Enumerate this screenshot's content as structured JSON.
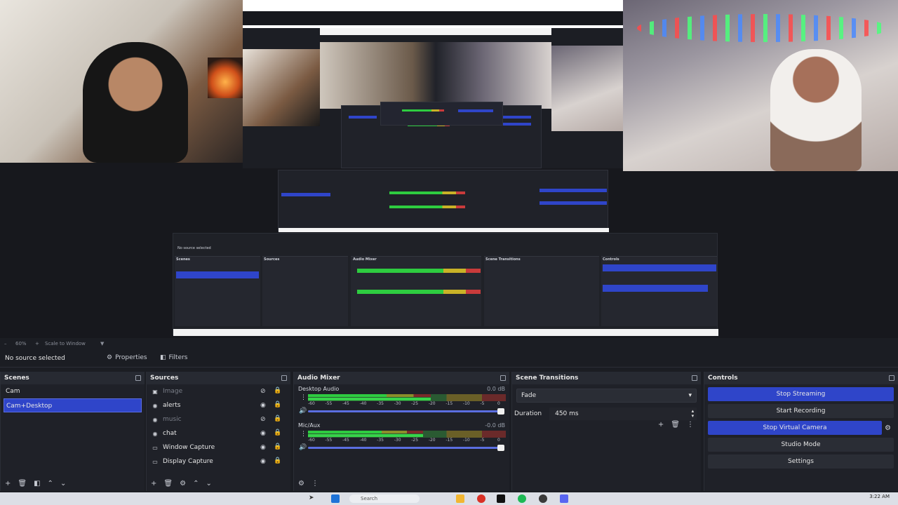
{
  "preview_toolbar": {
    "zoom": "60%",
    "scale_mode": "Scale to Window"
  },
  "source_toolbar": {
    "no_source": "No source selected",
    "properties": "Properties",
    "filters": "Filters"
  },
  "scenes": {
    "title": "Scenes",
    "items": [
      {
        "label": "Cam"
      },
      {
        "label": "Cam+Desktop",
        "selected": true
      }
    ]
  },
  "sources": {
    "title": "Sources",
    "items": [
      {
        "label": "Image",
        "icon": "image-icon",
        "visible": false
      },
      {
        "label": "alerts",
        "icon": "browser-icon",
        "visible": true
      },
      {
        "label": "music",
        "icon": "browser-icon",
        "visible": false
      },
      {
        "label": "chat",
        "icon": "browser-icon",
        "visible": true
      },
      {
        "label": "Window Capture",
        "icon": "window-icon",
        "visible": true
      },
      {
        "label": "Display Capture",
        "icon": "display-icon",
        "visible": true
      }
    ]
  },
  "mixer": {
    "title": "Audio Mixer",
    "channels": [
      {
        "name": "Desktop Audio",
        "db": "0.0 dB",
        "level": 0.62
      },
      {
        "name": "Mic/Aux",
        "db": "-0.0 dB",
        "level": 0.58
      }
    ],
    "scale": [
      "-60",
      "-55",
      "-45",
      "-40",
      "-35",
      "-30",
      "-25",
      "-20",
      "-15",
      "-10",
      "-5",
      "0"
    ]
  },
  "transitions": {
    "title": "Scene Transitions",
    "selected": "Fade",
    "duration_label": "Duration",
    "duration_value": "450 ms"
  },
  "controls": {
    "title": "Controls",
    "stop_streaming": "Stop Streaming",
    "start_recording": "Start Recording",
    "stop_virtual_camera": "Stop Virtual Camera",
    "studio_mode": "Studio Mode",
    "settings": "Settings"
  },
  "taskbar": {
    "search": "Search",
    "time": "3:22 AM"
  },
  "colors": {
    "accent": "#2f45c9",
    "panel_bg": "#1f2128",
    "title_bg": "#272a32"
  }
}
